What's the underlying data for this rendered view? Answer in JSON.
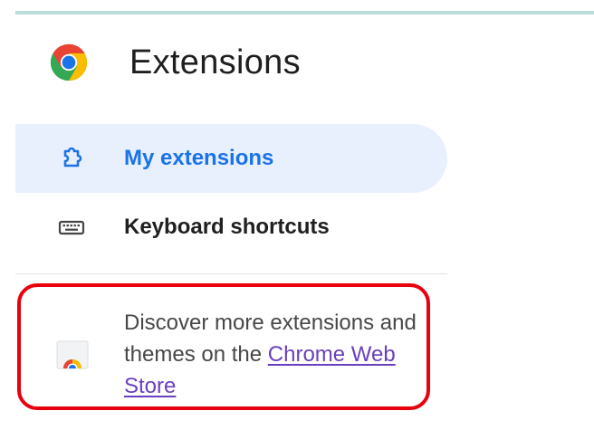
{
  "page": {
    "title": "Extensions",
    "logo_icon": "chrome-logo-icon"
  },
  "nav": {
    "items": [
      {
        "label": "My extensions",
        "icon": "puzzle-piece-icon",
        "active": true
      },
      {
        "label": "Keyboard shortcuts",
        "icon": "keyboard-icon",
        "active": false
      }
    ]
  },
  "promo": {
    "text": "Discover more extensions and themes on the",
    "link_text": "Chrome Web Store",
    "icon": "chrome-web-store-icon",
    "highlight_color": "#e8000f"
  },
  "colors": {
    "accent": "#1a73e8",
    "active_bg": "#e8f0fe",
    "link": "#6a3fbf",
    "top_strip": "#b9dcd9"
  }
}
